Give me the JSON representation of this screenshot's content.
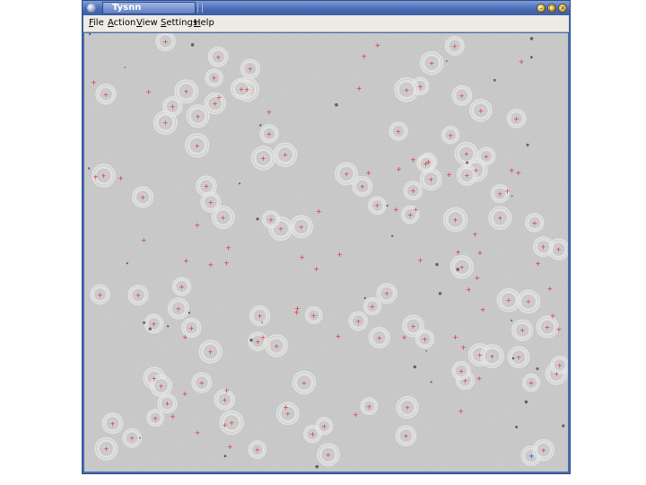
{
  "window": {
    "title": "Tysnn",
    "icon": "app-icon",
    "buttons": [
      {
        "name": "minimize-button",
        "glyph": "–"
      },
      {
        "name": "maximize-button",
        "glyph": "□"
      },
      {
        "name": "close-button",
        "glyph": "×"
      }
    ]
  },
  "menubar": {
    "items": [
      "File",
      "Action",
      "View",
      "Settings",
      "Help"
    ]
  },
  "micrograph": {
    "marker_color_default": "#d8323a",
    "marker_color_selected": "#2a3ad8",
    "particle_markers": 160,
    "selected_markers": 1
  }
}
